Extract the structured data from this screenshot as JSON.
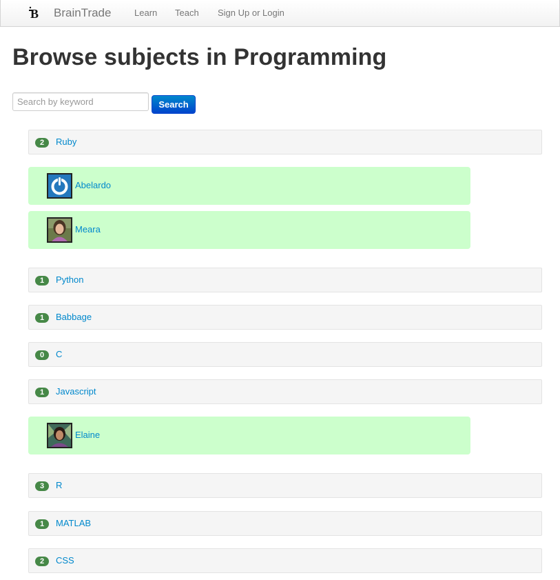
{
  "nav": {
    "brand": "BrainTrade",
    "links": [
      "Learn",
      "Teach",
      "Sign Up or Login"
    ]
  },
  "page": {
    "title": "Browse subjects in Programming"
  },
  "search": {
    "placeholder": "Search by keyword",
    "button_label": "Search"
  },
  "subjects": [
    {
      "count": "2",
      "name": "Ruby"
    },
    {
      "count": "1",
      "name": "Python"
    },
    {
      "count": "1",
      "name": "Babbage"
    },
    {
      "count": "0",
      "name": "C"
    },
    {
      "count": "1",
      "name": "Javascript"
    },
    {
      "count": "3",
      "name": "R"
    },
    {
      "count": "1",
      "name": "MATLAB"
    },
    {
      "count": "2",
      "name": "CSS"
    }
  ],
  "teachers": [
    {
      "name": "Abelardo",
      "avatar": "power-icon"
    },
    {
      "name": "Meara",
      "avatar": "person-photo"
    },
    {
      "name": "Elaine",
      "avatar": "person-photo"
    }
  ],
  "colors": {
    "badge": "#468847",
    "teacher_row": "#ccffcc",
    "link": "#0088cc",
    "search_button": "#0044cc"
  }
}
